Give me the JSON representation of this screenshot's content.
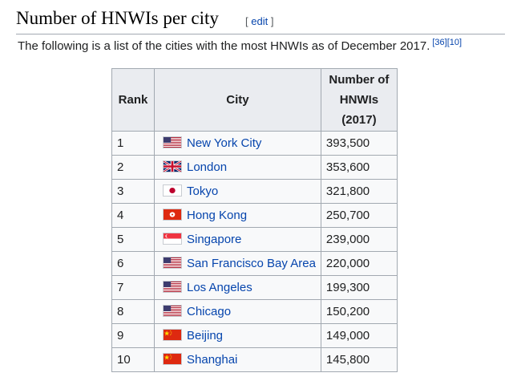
{
  "section": {
    "title": "Number of HNWIs per city",
    "edit_open": "[ ",
    "edit_label": "edit",
    "edit_close": " ]"
  },
  "intro": {
    "text": "The following is a list of the cities with the most HNWIs as of December 2017.",
    "refs": "[36][10]"
  },
  "table": {
    "headers": {
      "rank": "Rank",
      "city": "City",
      "count_line1": "Number of",
      "count_line2": "HNWIs",
      "count_line3": "(2017)"
    },
    "rows": [
      {
        "rank": "1",
        "city": "New York City",
        "flag": "usa-flag-icon",
        "count": "393,500"
      },
      {
        "rank": "2",
        "city": "London",
        "flag": "uk-flag-icon",
        "count": "353,600"
      },
      {
        "rank": "3",
        "city": "Tokyo",
        "flag": "japan-flag-icon",
        "count": "321,800"
      },
      {
        "rank": "4",
        "city": "Hong Kong",
        "flag": "hong-kong-flag-icon",
        "count": "250,700"
      },
      {
        "rank": "5",
        "city": "Singapore",
        "flag": "singapore-flag-icon",
        "count": "239,000"
      },
      {
        "rank": "6",
        "city": "San Francisco Bay Area",
        "flag": "usa-flag-icon",
        "count": "220,000"
      },
      {
        "rank": "7",
        "city": "Los Angeles",
        "flag": "usa-flag-icon",
        "count": "199,300"
      },
      {
        "rank": "8",
        "city": "Chicago",
        "flag": "usa-flag-icon",
        "count": "150,200"
      },
      {
        "rank": "9",
        "city": "Beijing",
        "flag": "china-flag-icon",
        "count": "149,000"
      },
      {
        "rank": "10",
        "city": "Shanghai",
        "flag": "china-flag-icon",
        "count": "145,800"
      }
    ]
  },
  "colors": {
    "link": "#0645ad",
    "border": "#a2a9b1",
    "header_bg": "#eaecf0",
    "cell_bg": "#f8f9fa"
  }
}
